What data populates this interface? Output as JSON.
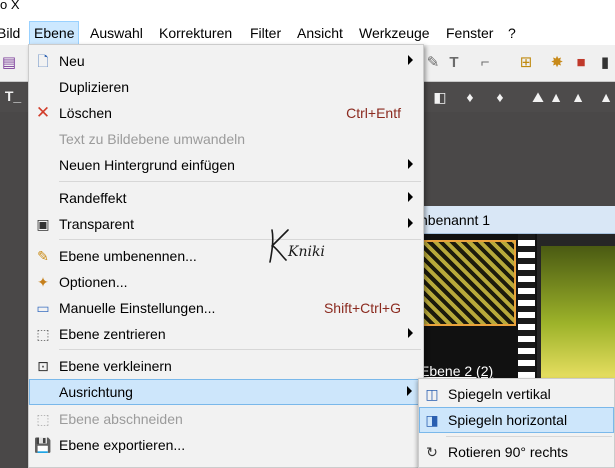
{
  "window": {
    "title_fragment": "o X"
  },
  "menubar": {
    "items": [
      "Bild",
      "Ebene",
      "Auswahl",
      "Korrekturen",
      "Filter",
      "Ansicht",
      "Werkzeuge",
      "Fenster",
      "?"
    ],
    "open_item": "Ebene"
  },
  "toolbar": {
    "icons": [
      "print-icon",
      "text-tool-icon",
      "crop-tool-icon",
      "layers-icon",
      "gear-icon",
      "palette-icon",
      "lock-icon"
    ],
    "row2_label": "T_",
    "row2_icons": [
      "droplet-icon",
      "droplet-icon",
      "droplet-icon",
      "droplet-icon",
      "mountain-icon",
      "triangle-icon",
      "triangle-icon",
      "triangle-icon"
    ]
  },
  "ebene_menu": {
    "items": [
      {
        "label": "Neu",
        "icon": "new-document-icon",
        "submenu": true
      },
      {
        "label": "Duplizieren"
      },
      {
        "label": "Löschen",
        "icon": "red-x-icon",
        "shortcut": "Ctrl+Entf"
      },
      {
        "label": "Text zu Bildebene umwandeln",
        "disabled": true
      },
      {
        "label": "Neuen Hintergrund einfügen",
        "submenu": true
      },
      {
        "label": "Randeffekt",
        "submenu": true
      },
      {
        "label": "Transparent",
        "icon": "transparency-icon",
        "submenu": true
      },
      {
        "label": "Ebene umbenennen...",
        "icon": "rename-icon"
      },
      {
        "label": "Optionen...",
        "icon": "options-icon"
      },
      {
        "label": "Manuelle Einstellungen...",
        "icon": "window-icon",
        "shortcut": "Shift+Ctrl+G"
      },
      {
        "label": "Ebene zentrieren",
        "icon": "center-icon",
        "submenu": true
      },
      {
        "label": "Ebene verkleinern",
        "icon": "shrink-icon"
      },
      {
        "label": "Ausrichtung",
        "submenu": true,
        "highlighted": true
      },
      {
        "label": "Ebene abschneiden",
        "icon": "cut-icon",
        "disabled": true
      },
      {
        "label": "Ebene exportieren...",
        "icon": "floppy-icon"
      }
    ]
  },
  "ausrichtung_submenu": {
    "items": [
      {
        "label": "Spiegeln vertikal",
        "icon": "mirror-vertical-icon"
      },
      {
        "label": "Spiegeln horizontal",
        "icon": "mirror-horizontal-icon",
        "highlighted": true
      },
      {
        "label": "Rotieren 90° rechts",
        "icon": "rotate-right-icon"
      }
    ]
  },
  "document": {
    "title_fragment": "nbenannt 1",
    "layer_label": "Ebene 2 (2)"
  },
  "watermark": {
    "text": "Kniki"
  }
}
